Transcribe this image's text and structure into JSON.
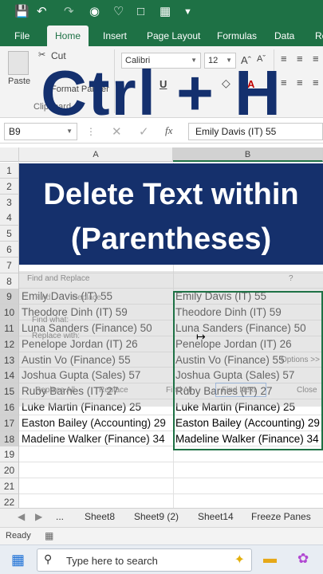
{
  "window": {
    "accent": "#1e7145"
  },
  "ribbon_tabs": [
    "File",
    "Home",
    "Insert",
    "Page Layout",
    "Formulas",
    "Data",
    "Re"
  ],
  "clipboard": {
    "paste": "Paste",
    "cut": "Cut",
    "format_painter": "Format Painter",
    "group": "Clipboard"
  },
  "font": {
    "name": "Calibri",
    "size": "12"
  },
  "overlay_title": "Ctrl + H",
  "formula_bar": {
    "name_box": "B9",
    "fx": "fx",
    "value": "Emily Davis (IT) 55"
  },
  "columns": [
    "A",
    "B"
  ],
  "rows": [
    "1",
    "2",
    "3",
    "4",
    "5",
    "6",
    "7",
    "8",
    "9",
    "10",
    "11",
    "12",
    "13",
    "14",
    "15",
    "16",
    "17",
    "18",
    "19",
    "20",
    "21",
    "22"
  ],
  "banner": {
    "line1": "Delete Text within",
    "line2": "(Parentheses)",
    "color": "#15306c"
  },
  "dialog": {
    "title": "Find and Replace",
    "help": "?",
    "find_tab": "Find",
    "replace_tab": "Replace",
    "find_what": "Find what:",
    "replace_with": "Replace with:",
    "options": "Options >>",
    "replace_all": "Replace All",
    "replace": "Replace",
    "find_all": "Find All",
    "find_next": "Find Next",
    "close": "Close"
  },
  "col_a": [
    "Emily Davis (IT) 55",
    "Theodore Dinh (IT) 59",
    "Luna Sanders (Finance) 50",
    "Penelope Jordan (IT) 26",
    "Austin Vo (Finance) 55",
    "Joshua Gupta (Sales) 57",
    "Ruby Barnes (IT) 27",
    "Luke Martin (Finance) 25",
    "Easton Bailey (Accounting) 29",
    "Madeline Walker (Finance) 34"
  ],
  "col_b": [
    "Emily Davis (IT) 55",
    "Theodore Dinh (IT) 59",
    "Luna Sanders (Finance) 50",
    "Penelope Jordan (IT) 26",
    "Austin Vo (Finance) 55",
    "Joshua Gupta (Sales) 57",
    "Ruby Barnes (IT) 27",
    "Luke Martin (Finance) 25",
    "Easton Bailey (Accounting) 29",
    "Madeline Walker (Finance) 34"
  ],
  "sheet_tabs": [
    "...",
    "Sheet8",
    "Sheet9 (2)",
    "Sheet14",
    "Freeze Panes"
  ],
  "status": {
    "ready": "Ready"
  },
  "taskbar": {
    "search_placeholder": "Type here to search"
  }
}
